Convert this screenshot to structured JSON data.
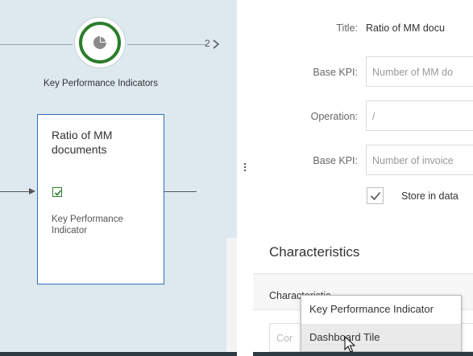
{
  "process_flow": {
    "step": {
      "icon": "pie-chart-icon",
      "label": "Key Performance Indicators",
      "count": "2",
      "accent_color": "#2b7d2b"
    },
    "node": {
      "title": "Ratio of MM documents",
      "checked": true,
      "type_label": "Key Performance Indicator",
      "border_color": "#2c6fb5"
    }
  },
  "form": {
    "title_label": "Title:",
    "title_value": "Ratio of MM docu",
    "base_kpi_1_label": "Base KPI:",
    "base_kpi_1_placeholder": "Number of MM do",
    "operation_label": "Operation:",
    "operation_value": "/",
    "base_kpi_2_label": "Base KPI:",
    "base_kpi_2_placeholder": "Number of invoice",
    "store_checked": true,
    "store_label": "Store in data"
  },
  "characteristics": {
    "section_title": "Characteristics",
    "column_header": "Characteristic",
    "row_placeholder": "Cor"
  },
  "dropdown": {
    "options": [
      "Key Performance Indicator",
      "Dashboard Tile"
    ],
    "hovered_index": 1
  }
}
